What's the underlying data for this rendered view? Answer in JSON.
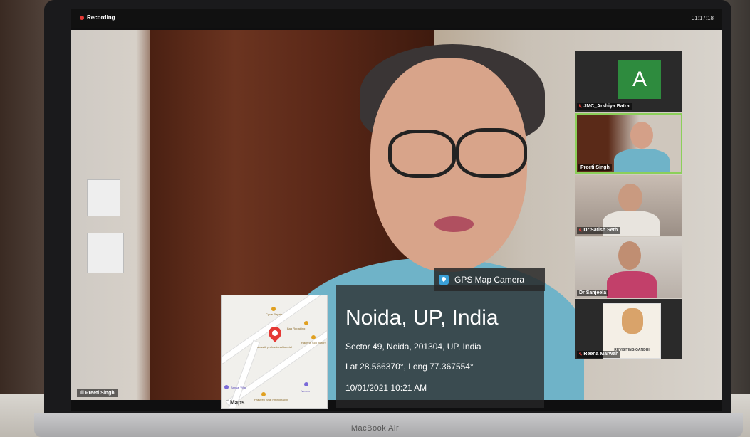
{
  "meeting": {
    "recording_label": "Recording",
    "timer": "01:17:18",
    "main_speaker_name": "Preeti Singh"
  },
  "participants": [
    {
      "name": "JMC_Arshiya Batra",
      "avatar_letter": "A",
      "muted": true
    },
    {
      "name": "Preeti Singh",
      "active": true
    },
    {
      "name": "Dr Satish Seth",
      "muted": true
    },
    {
      "name": "Dr Sanjeela"
    },
    {
      "name": "Reena Marwah",
      "muted": true
    }
  ],
  "gps_overlay": {
    "app_name": "GPS Map Camera",
    "city": "Noida, UP, India",
    "address": "Sector 49, Noida, 201304, UP, India",
    "coordinates": "Lat 28.566370°, Long 77.367554°",
    "datetime": "10/01/2021 10:21 AM",
    "map_brand": "Maps",
    "map_labels": [
      "Cycle Repair",
      "Bag Repairing",
      "Rachna Sch picture",
      "swastik professional tutorial",
      "Bansal Villa",
      "Verma",
      "Praveen Bhat Photography"
    ]
  },
  "device": {
    "label": "MacBook Air"
  },
  "colors": {
    "avatar_bg": "#2e8b3e",
    "active_speaker_border": "#8ccf5a",
    "recording_dot": "#e53935"
  }
}
